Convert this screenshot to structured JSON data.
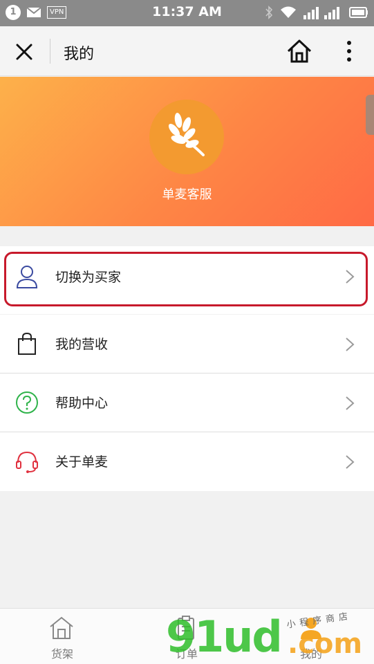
{
  "status_bar": {
    "notification_count": "1",
    "vpn_label": "VPN",
    "time": "11:37 AM",
    "icons": [
      "mail-icon",
      "bluetooth-icon",
      "wifi-icon",
      "signal-icon",
      "battery-icon"
    ]
  },
  "nav": {
    "title": "我的",
    "icons": [
      "close-icon",
      "home-icon",
      "more-icon"
    ]
  },
  "profile": {
    "name": "单麦客服",
    "avatar_icon": "wheat-icon"
  },
  "menu": {
    "items": [
      {
        "label": "切换为买家",
        "icon": "user-icon"
      },
      {
        "label": "我的营收",
        "icon": "shopping-bag-icon"
      },
      {
        "label": "帮助中心",
        "icon": "help-icon"
      },
      {
        "label": "关于单麦",
        "icon": "headset-icon"
      }
    ]
  },
  "tabbar": {
    "tabs": [
      {
        "label": "货架",
        "icon": "store-icon"
      },
      {
        "label": "订单",
        "icon": "clipboard-icon"
      },
      {
        "label": "我的",
        "icon": "person-icon"
      }
    ]
  },
  "watermark": {
    "digits": "91ud",
    "domain": ".com",
    "tagline": "小程序商店"
  },
  "colors": {
    "accent_red": "#c7192b",
    "hero_start": "#fdb14a",
    "hero_end": "#ff6a45",
    "avatar_bg": "#f39a30",
    "icon_blue": "#3a4aa0",
    "icon_green": "#2fb34a",
    "icon_red": "#e0313f"
  }
}
